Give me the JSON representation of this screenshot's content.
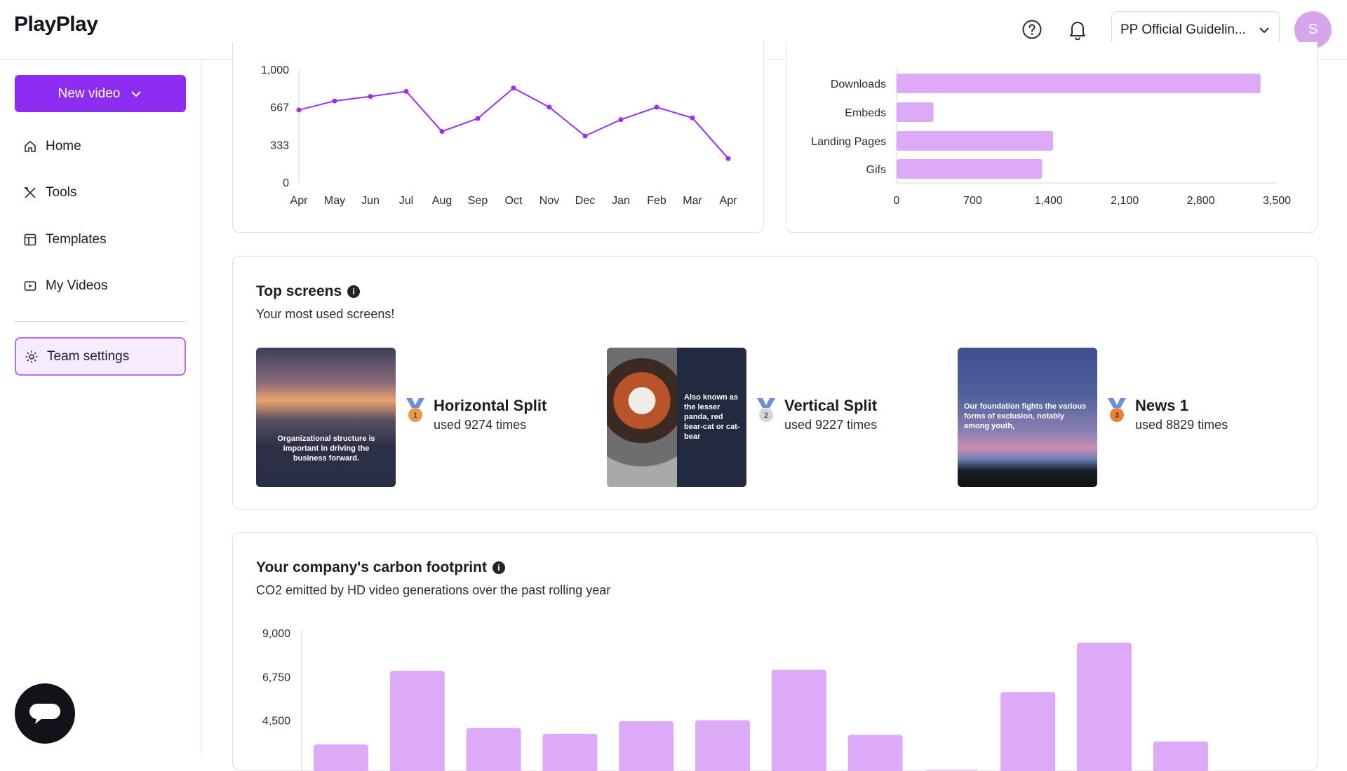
{
  "header": {
    "logo": "PlayPlay",
    "workspace": "PP Official Guidelin...",
    "avatar_initial": "S"
  },
  "sidebar": {
    "new_video_label": "New video",
    "items": [
      {
        "label": "Home",
        "icon": "home-icon"
      },
      {
        "label": "Tools",
        "icon": "tools-icon"
      },
      {
        "label": "Templates",
        "icon": "templates-icon"
      },
      {
        "label": "My Videos",
        "icon": "videos-icon"
      }
    ],
    "team_settings_label": "Team settings"
  },
  "line_chart": {
    "chart_data": {
      "type": "line",
      "categories": [
        "Apr",
        "May",
        "Jun",
        "Jul",
        "Aug",
        "Sep",
        "Oct",
        "Nov",
        "Dec",
        "Jan",
        "Feb",
        "Mar",
        "Apr"
      ],
      "values": [
        640,
        720,
        760,
        805,
        450,
        565,
        835,
        665,
        410,
        555,
        665,
        570,
        210
      ],
      "yticks": [
        "0",
        "333",
        "667",
        "1,000"
      ],
      "ylim": [
        0,
        1000
      ],
      "color": "#9b30ee"
    }
  },
  "bar_chart": {
    "chart_data": {
      "type": "bar",
      "orientation": "horizontal",
      "categories": [
        "Downloads",
        "Embeds",
        "Landing Pages",
        "Gifs"
      ],
      "values": [
        3350,
        340,
        1440,
        1340
      ],
      "xticks": [
        "0",
        "700",
        "1,400",
        "2,100",
        "2,800",
        "3,500"
      ],
      "xlim": [
        0,
        3500
      ],
      "color": "#dcaaf6"
    }
  },
  "top_screens": {
    "title": "Top screens",
    "subtitle": "Your most used screens!",
    "items": [
      {
        "name": "Horizontal Split",
        "uses": "used 9274 times",
        "rank": "1",
        "thumb_text": "Organizational structure is important in driving the business forward."
      },
      {
        "name": "Vertical Split",
        "uses": "used 9227 times",
        "rank": "2",
        "thumb_text": "Also known as the lesser panda, red bear-cat or cat-bear"
      },
      {
        "name": "News 1",
        "uses": "used 8829 times",
        "rank": "3",
        "thumb_text": "Our foundation fights the various forms of exclusion, notably among youth,"
      }
    ]
  },
  "carbon": {
    "title": "Your company's carbon footprint",
    "subtitle": "CO2 emitted by HD video generations over the past rolling year",
    "chart_data": {
      "type": "bar",
      "yticks": [
        "4,500",
        "6,750",
        "9,000"
      ],
      "ylim": [
        0,
        9000
      ],
      "values": [
        3250,
        7050,
        4100,
        3800,
        4450,
        4500,
        7100,
        3750,
        1900,
        5950,
        8500,
        3400
      ],
      "color": "#dcaaf6"
    }
  }
}
